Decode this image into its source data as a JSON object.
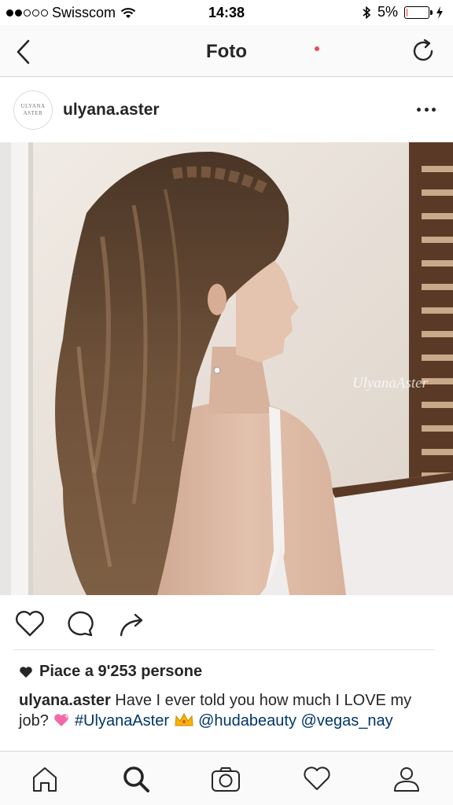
{
  "status_bar": {
    "carrier": "Swisscom",
    "time": "14:38",
    "battery": "5%",
    "battery_level": 0.05,
    "signal_bars_filled": 2,
    "signal_bars_total": 5
  },
  "nav": {
    "title": "Foto",
    "back_icon": "chevron-left-icon",
    "refresh_icon": "refresh-icon"
  },
  "post": {
    "avatar_text_line1": "ULYANA",
    "avatar_text_line2": "ASTER",
    "username": "ulyana.aster",
    "more_icon": "more-horizontal-icon",
    "watermark": "UlyanaAster"
  },
  "actions": {
    "like_icon": "heart-outline-icon",
    "comment_icon": "comment-icon",
    "share_icon": "share-icon"
  },
  "likes": {
    "text": "Piace a 9'253 persone"
  },
  "caption": {
    "username": "ulyana.aster",
    "text": " Have I ever told you how much I LOVE my job? ",
    "hashtag": "#UlyanaAster",
    "mention1": "@hudabeauty",
    "mention2": "@vegas_nay"
  },
  "tab_bar": {
    "items": [
      "home-icon",
      "search-icon",
      "camera-icon",
      "activity-heart-icon",
      "profile-icon"
    ],
    "active": "search-icon"
  },
  "colors": {
    "link": "#003569",
    "text": "#262626",
    "notification": "#ed4956"
  }
}
